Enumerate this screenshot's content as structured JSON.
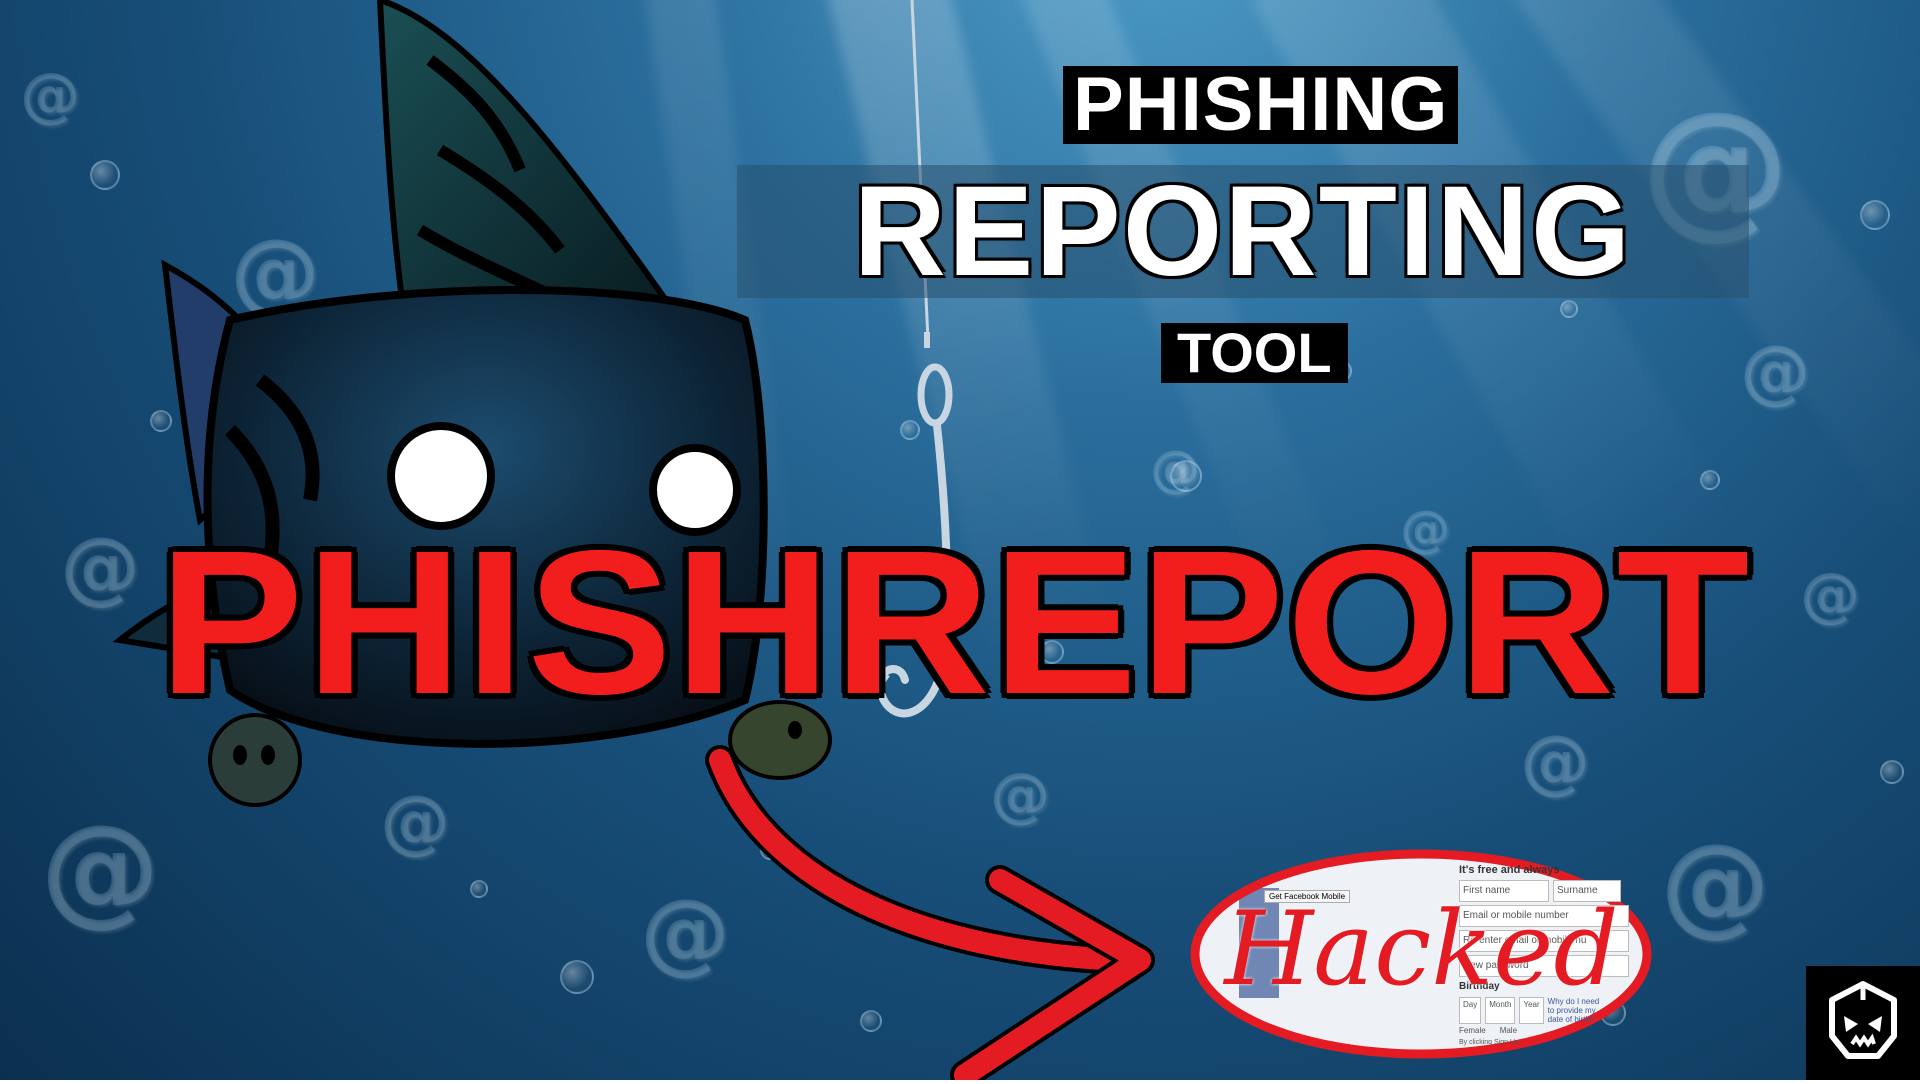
{
  "headline": {
    "line1": "PHISHING",
    "line2": "REPORTING",
    "line3": "TOOL"
  },
  "main_title": "PHISHREPORT",
  "hacked_label": "Hacked",
  "form_snippet": {
    "tagline": "It's free and always",
    "first_name": "First name",
    "surname": "Surname",
    "email": "Email or mobile number",
    "reenter": "Re-enter email or mobile nu",
    "new_password": "New password",
    "birthday": "Birthday",
    "day": "Day",
    "month": "Month",
    "year": "Year",
    "why": "Why do I need to provide my date of birth?",
    "female": "Female",
    "male": "Male",
    "get_mobile": "Get Facebook Mobile",
    "clicking": "By clicking Sign Up"
  },
  "colors": {
    "title_red": "#f21d1d",
    "ocean_dark": "#0b2f4f",
    "ocean_light": "#4f9ec9",
    "hacked_red": "#e41b23"
  },
  "icons": [
    "fish-mascot-icon",
    "fishing-hook-icon",
    "curved-arrow-icon",
    "brand-logo-icon"
  ]
}
